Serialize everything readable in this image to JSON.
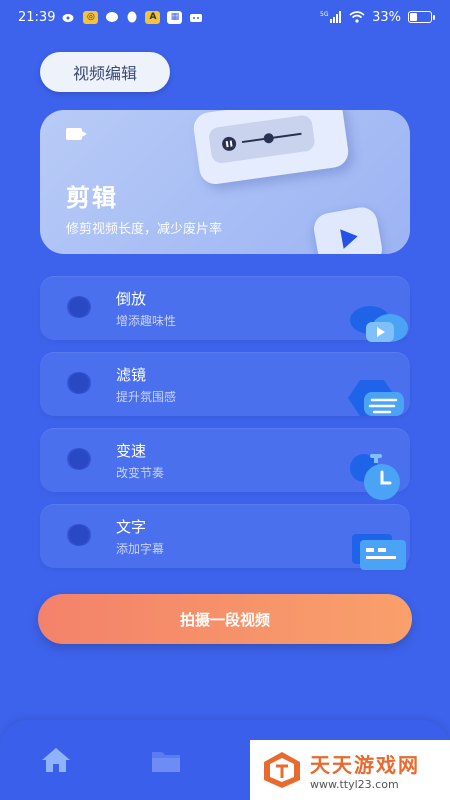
{
  "status_bar": {
    "time": "21:39",
    "network": "5G",
    "battery": "33%"
  },
  "tab": {
    "label": "视频编辑"
  },
  "hero": {
    "title": "剪辑",
    "subtitle": "修剪视频长度，减少废片率"
  },
  "features": [
    {
      "label": "倒放",
      "subtitle": "增添趣味性",
      "icon": "reverse-play-icon"
    },
    {
      "label": "滤镜",
      "subtitle": "提升氛围感",
      "icon": "filter-icon"
    },
    {
      "label": "变速",
      "subtitle": "改变节奏",
      "icon": "speed-clock-icon"
    },
    {
      "label": "文字",
      "subtitle": "添加字幕",
      "icon": "text-caption-icon"
    }
  ],
  "cta": {
    "label": "拍摄一段视频"
  },
  "nav": {
    "items": [
      "home-icon",
      "folder-icon"
    ]
  },
  "watermark": {
    "main": "天天游戏网",
    "sub": "www.ttyl23.com"
  },
  "colors": {
    "background": "#3d63ec",
    "accent_cta": "#f58a6a",
    "brand_watermark": "#e86a2f"
  }
}
